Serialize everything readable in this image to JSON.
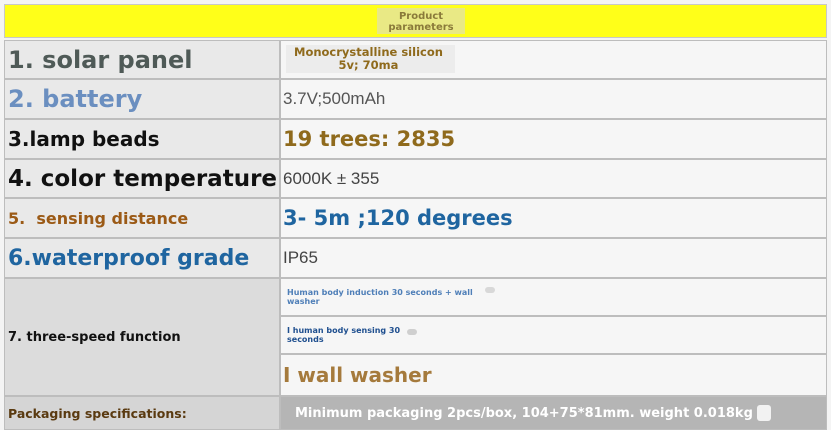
{
  "header": {
    "title": "Product parameters"
  },
  "colors": {
    "header_bg": "#ffff19",
    "gray_text": "#4f5a57",
    "blue_light": "#6b8fc0",
    "brown": "#9b5a16",
    "blue_dark": "#1f65a0",
    "gold": "#8f6a1c",
    "footer_bg": "#b5b5b5"
  },
  "rows": [
    {
      "label": "1. solar panel",
      "value_line1": "Monocrystalline silicon",
      "value_line2": "5v; 70ma"
    },
    {
      "label": "2. battery",
      "value": "3.7V;500mAh"
    },
    {
      "label": "3.lamp beads",
      "value": "19 trees: 2835"
    },
    {
      "label": "4. color temperature",
      "value": "6000K ± 355"
    },
    {
      "label": "5.  sensing distance",
      "value": "3- 5m ;120 degrees"
    },
    {
      "label": "6.waterproof grade",
      "value": "IP65"
    }
  ],
  "function_row": {
    "label": "7. three-speed function",
    "options": [
      "Human body induction 30 seconds + wall washer",
      "I human body sensing 30 seconds",
      "I wall washer"
    ]
  },
  "packaging": {
    "label": "Packaging specifications:",
    "value": "Minimum packaging 2pcs/box, 104+75*81mm. weight 0.018kg"
  }
}
